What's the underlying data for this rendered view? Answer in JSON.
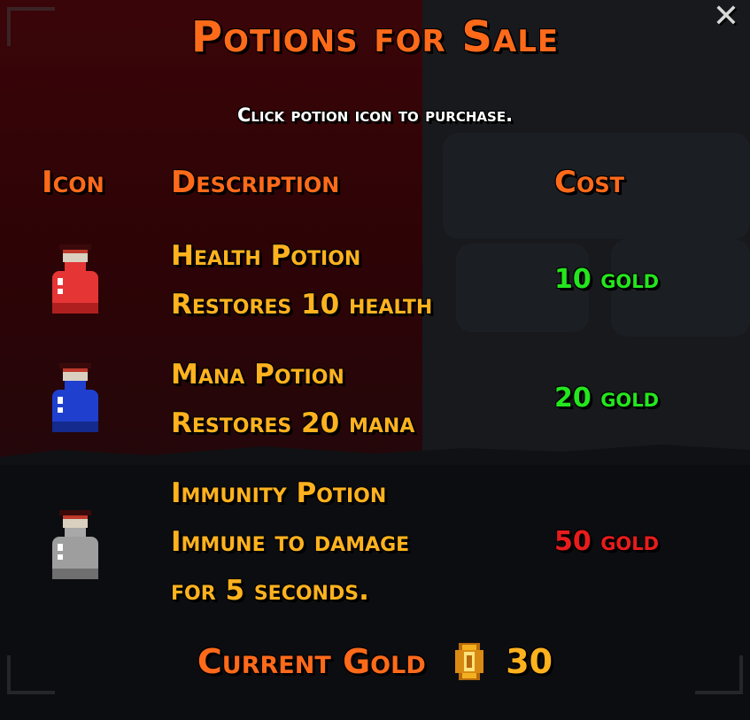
{
  "title": "Potions for Sale",
  "subtitle": "Click potion icon to purchase.",
  "close_icon": "close-icon",
  "headers": {
    "icon": "Icon",
    "description": "Description",
    "cost": "Cost"
  },
  "potions": [
    {
      "name": "Health Potion",
      "lines": [
        "Health Potion",
        "Restores 10 health"
      ],
      "cost": "10 gold",
      "cost_color": "#24e61e",
      "potion_color": "#e53535",
      "icon": "health-potion-icon"
    },
    {
      "name": "Mana Potion",
      "lines": [
        "Mana Potion",
        "Restores 20 mana"
      ],
      "cost": "20 gold",
      "cost_color": "#24e61e",
      "potion_color": "#1f3fcf",
      "icon": "mana-potion-icon"
    },
    {
      "name": "Immunity Potion",
      "lines": [
        "Immunity Potion",
        "Immune to damage",
        "for 5 seconds."
      ],
      "cost": "50 gold",
      "cost_color": "#e81c1c",
      "potion_color": "#9e9e9e",
      "icon": "immunity-potion-icon"
    }
  ],
  "footer": {
    "label": "Current Gold",
    "icon": "gold-coin-icon",
    "value": "30"
  },
  "colors": {
    "title": "#ff6a1a",
    "text": "#ffb21e",
    "affordable": "#24e61e",
    "unaffordable": "#e81c1c"
  }
}
